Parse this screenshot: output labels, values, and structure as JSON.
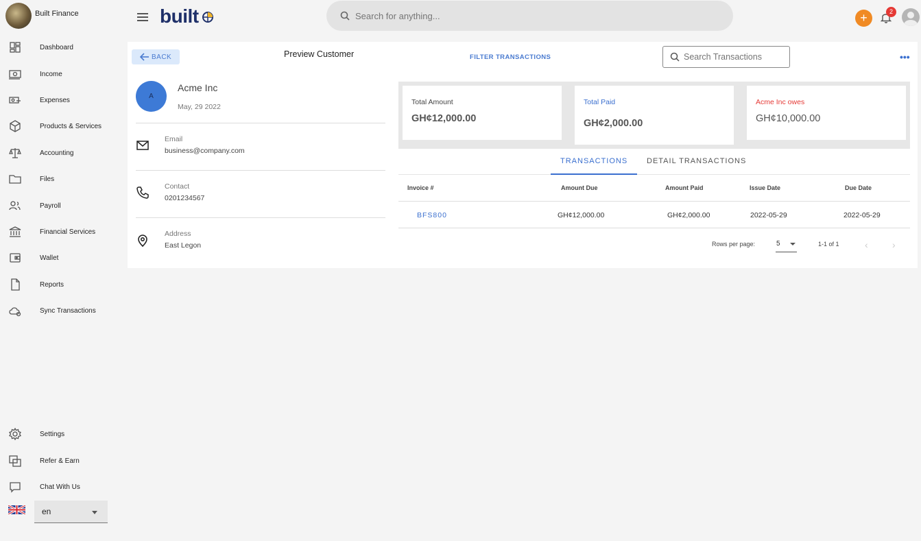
{
  "org": {
    "name": "Built Finance"
  },
  "sidebar": {
    "items": [
      {
        "label": "Dashboard",
        "icon": "dashboard-icon"
      },
      {
        "label": "Income",
        "icon": "cash-icon"
      },
      {
        "label": "Expenses",
        "icon": "expense-icon"
      },
      {
        "label": "Products & Services",
        "icon": "box-icon"
      },
      {
        "label": "Accounting",
        "icon": "scale-icon"
      },
      {
        "label": "Files",
        "icon": "folder-icon"
      },
      {
        "label": "Payroll",
        "icon": "people-icon"
      },
      {
        "label": "Financial Services",
        "icon": "bank-icon"
      },
      {
        "label": "Wallet",
        "icon": "wallet-icon"
      },
      {
        "label": "Reports",
        "icon": "document-icon"
      },
      {
        "label": "Sync Transactions",
        "icon": "cloud-sync-icon"
      }
    ],
    "bottom_items": [
      {
        "label": "Settings",
        "icon": "gear-icon"
      },
      {
        "label": "Refer & Earn",
        "icon": "refer-icon"
      },
      {
        "label": "Chat With Us",
        "icon": "chat-icon"
      }
    ],
    "language": "en"
  },
  "header": {
    "brand": "built",
    "search_placeholder": "Search for anything...",
    "notification_count": "2",
    "add_label": "+"
  },
  "page": {
    "back_label": "BACK",
    "title": "Preview Customer",
    "filter_label": "FILTER TRANSACTIONS",
    "search_placeholder": "Search Transactions",
    "more_label": "•••"
  },
  "customer": {
    "initial": "A",
    "name": "Acme Inc",
    "date": "May, 29 2022",
    "email_label": "Email",
    "email": "business@company.com",
    "contact_label": "Contact",
    "contact": "0201234567",
    "address_label": "Address",
    "address": "East Legon"
  },
  "summary": {
    "total_amount_label": "Total Amount",
    "total_amount": "GH¢12,000.00",
    "total_paid_label": "Total Paid",
    "total_paid": "GH¢2,000.00",
    "owes_label": "Acme Inc owes",
    "owes": "GH¢10,000.00",
    "paid_color": "#3a6fcf",
    "owes_color": "#e53935"
  },
  "tabs": [
    "TRANSACTIONS",
    "DETAIL TRANSACTIONS"
  ],
  "table": {
    "headers": [
      "Invoice #",
      "Amount Due",
      "Amount Paid",
      "Issue Date",
      "Due Date"
    ],
    "rows": [
      [
        "BFS800",
        "GH¢12,000.00",
        "GH¢2,000.00",
        "2022-05-29",
        "2022-05-29"
      ]
    ]
  },
  "pagination": {
    "rows_per_page_label": "Rows per page:",
    "rows_per_page": "5",
    "range": "1-1 of 1"
  }
}
